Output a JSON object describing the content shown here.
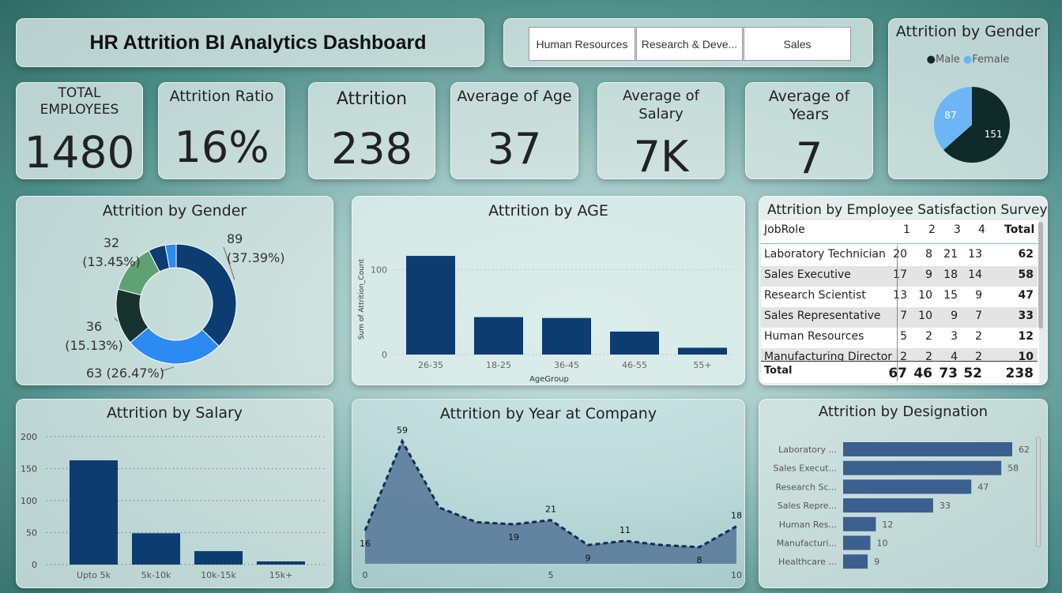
{
  "header": {
    "title": "HR Attrition BI Analytics Dashboard"
  },
  "slicer": {
    "options": [
      "Human Resources",
      "Research & Deve...",
      "Sales"
    ]
  },
  "kpis": {
    "total_employees": {
      "label_line1": "TOTAL",
      "label_line2": "EMPLOYEES",
      "value": "1480"
    },
    "attrition_ratio": {
      "label": "Attrition Ratio",
      "value": "16%"
    },
    "attrition": {
      "label": "Attrition",
      "value": "238"
    },
    "avg_age": {
      "label": "Average of Age",
      "value": "37"
    },
    "avg_salary": {
      "label_line1": "Average of",
      "label_line2": "Salary",
      "value": "7K"
    },
    "avg_years": {
      "label_line1": "Average of",
      "label_line2": "Years",
      "value": "7"
    }
  },
  "colors": {
    "navy": "#0d3c70",
    "dark_green": "#16332f",
    "blue": "#2b8bf2",
    "green": "#5ea273",
    "light_blue": "#6cb6f6",
    "area_fill": "#5f7f9e",
    "bar_slate": "#3b5f8e"
  },
  "chart_data": [
    {
      "id": "gender_pie",
      "type": "pie",
      "title": "Attrition by Gender",
      "legend": [
        "Male",
        "Female"
      ],
      "legend_position": "top",
      "slices": [
        {
          "label": "Male",
          "value": 151,
          "color": "#0f2a28"
        },
        {
          "label": "Female",
          "value": 87,
          "color": "#6cb6f6"
        }
      ]
    },
    {
      "id": "gender_donut",
      "type": "pie",
      "title": "Attrition by Gender",
      "slices": [
        {
          "value": 89,
          "label": "89",
          "pct": "(37.39%)",
          "color": "#0d3c70"
        },
        {
          "value": 63,
          "label": "63 (26.47%)",
          "pct": "",
          "color": "#2b8bf2"
        },
        {
          "value": 36,
          "label": "36",
          "pct": "(15.13%)",
          "color": "#16332f"
        },
        {
          "value": 32,
          "label": "32",
          "pct": "(13.45%)",
          "color": "#5ea273"
        },
        {
          "value": 11,
          "label": "",
          "pct": "",
          "color": "#0d3c70"
        },
        {
          "value": 7,
          "label": "",
          "pct": "",
          "color": "#2b8bf2"
        }
      ]
    },
    {
      "id": "age_bar",
      "type": "bar",
      "title": "Attrition by AGE",
      "xlabel": "AgeGroup",
      "ylabel": "Sum of Attrition_Count",
      "categories": [
        "26-35",
        "18-25",
        "36-45",
        "46-55",
        "55+"
      ],
      "values": [
        116,
        44,
        43,
        27,
        8
      ],
      "yticks": [
        0,
        100
      ],
      "ylim": [
        0,
        130
      ],
      "grid": true
    },
    {
      "id": "satisfaction_matrix",
      "type": "table",
      "title": "Attrition by Employee Satisfaction Survey",
      "columns": [
        "JobRole",
        "1",
        "2",
        "3",
        "4",
        "Total"
      ],
      "rows": [
        [
          "Laboratory Technician",
          "20",
          "8",
          "21",
          "13",
          "62"
        ],
        [
          "Sales Executive",
          "17",
          "9",
          "18",
          "14",
          "58"
        ],
        [
          "Research Scientist",
          "13",
          "10",
          "15",
          "9",
          "47"
        ],
        [
          "Sales Representative",
          "7",
          "10",
          "9",
          "7",
          "33"
        ],
        [
          "Human Resources",
          "5",
          "2",
          "3",
          "2",
          "12"
        ],
        [
          "Manufacturing Director",
          "2",
          "2",
          "4",
          "2",
          "10"
        ]
      ],
      "total_row": [
        "Total",
        "67",
        "46",
        "73",
        "52",
        "238"
      ]
    },
    {
      "id": "salary_bar",
      "type": "bar",
      "title": "Attrition by Salary",
      "categories": [
        "Upto 5k",
        "5k-10k",
        "10k-15k",
        "15k+"
      ],
      "values": [
        163,
        49,
        21,
        5
      ],
      "yticks": [
        0,
        50,
        100,
        150,
        200
      ],
      "ylim": [
        0,
        200
      ],
      "grid": true
    },
    {
      "id": "years_area",
      "type": "area",
      "title": "Attrition by Year at Company",
      "x": [
        0,
        1,
        2,
        3,
        4,
        5,
        6,
        7,
        8,
        9,
        10
      ],
      "y": [
        16,
        59,
        27,
        20,
        19,
        21,
        9,
        11,
        9,
        8,
        18
      ],
      "labels": [
        "16",
        "59",
        "",
        "",
        "19",
        "21",
        "9",
        "11",
        "",
        "8",
        "18"
      ],
      "xticks": [
        0,
        5,
        10
      ],
      "ylim": [
        0,
        60
      ]
    },
    {
      "id": "designation_bar",
      "type": "bar",
      "orientation": "horizontal",
      "title": "Attrition by Designation",
      "categories": [
        "Laboratory ...",
        "Sales Execut...",
        "Research Sc...",
        "Sales Repre...",
        "Human Res...",
        "Manufacturi...",
        "Healthcare ..."
      ],
      "values": [
        62,
        58,
        47,
        33,
        12,
        10,
        9
      ],
      "xlim": [
        0,
        62
      ]
    }
  ]
}
